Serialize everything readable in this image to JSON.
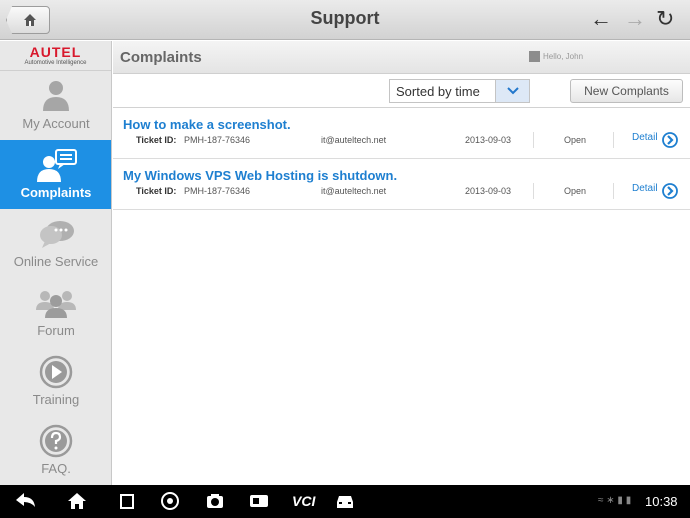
{
  "header": {
    "title": "Support"
  },
  "sidebar": {
    "logo": {
      "brand": "AUTEL",
      "tagline": "Automotive Intelligence"
    },
    "items": [
      {
        "label": "My Account",
        "icon": "person-icon",
        "active": false
      },
      {
        "label": "Complaints",
        "icon": "complaint-icon",
        "active": true
      },
      {
        "label": "Online Service",
        "icon": "chat-bubble-icon",
        "active": false
      },
      {
        "label": "Forum",
        "icon": "group-icon",
        "active": false
      },
      {
        "label": "Training",
        "icon": "play-icon",
        "active": false
      },
      {
        "label": "FAQ.",
        "icon": "question-icon",
        "active": false
      }
    ]
  },
  "main": {
    "title": "Complaints",
    "greeting": "Hello, John",
    "sort": {
      "selected": "Sorted by time"
    },
    "new_button": "New Complants",
    "tickets": [
      {
        "title": "How to make a screenshot.",
        "ticket_label": "Ticket ID:",
        "ticket_id": "PMH-187-76346",
        "email": "it@auteltech.net",
        "date": "2013-09-03",
        "status": "Open",
        "action": "Detail"
      },
      {
        "title": "My Windows VPS Web Hosting is shutdown.",
        "ticket_label": "Ticket ID:",
        "ticket_id": "PMH-187-76346",
        "email": "it@auteltech.net",
        "date": "2013-09-03",
        "status": "Open",
        "action": "Detail"
      }
    ]
  },
  "status_bar": {
    "time": "10:38",
    "vci_label": "VCI"
  },
  "colors": {
    "accent": "#1e90e4",
    "link": "#1e7fd0",
    "brand": "#d8182c"
  }
}
